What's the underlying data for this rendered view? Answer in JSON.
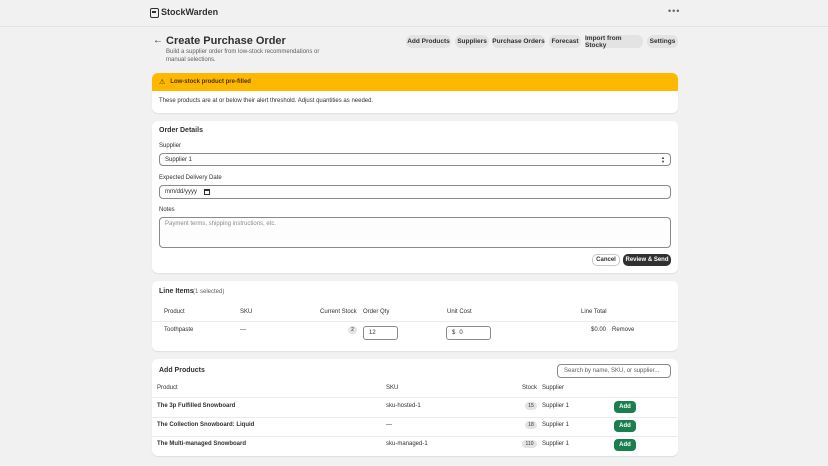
{
  "app": {
    "name": "StockWarden",
    "more_icon": "more-horizontal-icon"
  },
  "header": {
    "title": "Create Purchase Order",
    "subtitle": "Build a supplier order from low-stock recommendations or manual selections.",
    "back_icon": "arrow-left-icon"
  },
  "nav": {
    "tabs": [
      {
        "label": "Add Products"
      },
      {
        "label": "Suppliers"
      },
      {
        "label": "Purchase Orders"
      },
      {
        "label": "Forecast"
      },
      {
        "label": "Import from Stocky"
      },
      {
        "label": "Settings"
      }
    ]
  },
  "banner": {
    "title": "Low-stock product pre-filled",
    "body": "These products are at or below their alert threshold. Adjust quantities as needed.",
    "icon": "warning-icon",
    "color": "#ffb800"
  },
  "order_details": {
    "title": "Order Details",
    "supplier_label": "Supplier",
    "supplier_value": "Supplier 1",
    "delivery_label": "Expected Delivery Date",
    "delivery_value": "mm/dd/yyyy",
    "notes_label": "Notes",
    "notes_placeholder": "Payment terms, shipping instructions, etc.",
    "cancel_label": "Cancel",
    "submit_label": "Review & Send"
  },
  "line_items": {
    "title": "Line Items",
    "selected_text": "(1 selected)",
    "columns": [
      "Product",
      "SKU",
      "Current Stock",
      "Order Qty",
      "Unit Cost",
      "Line Total"
    ],
    "rows": [
      {
        "product": "Toothpaste",
        "sku": "—",
        "stock": "2",
        "qty": "12",
        "currency": "$",
        "cost": "0",
        "total": "$0.00",
        "remove": "Remove"
      }
    ]
  },
  "add_products": {
    "title": "Add Products",
    "search_placeholder": "Search by name, SKU, or supplier...",
    "columns": [
      "Product",
      "SKU",
      "Stock",
      "Supplier"
    ],
    "rows": [
      {
        "product": "The 3p Fulfilled Snowboard",
        "sku": "sku-hosted-1",
        "stock": "15",
        "supplier": "Supplier 1",
        "action": "Add"
      },
      {
        "product": "The Collection Snowboard: Liquid",
        "sku": "—",
        "stock": "18",
        "supplier": "Supplier 1",
        "action": "Add"
      },
      {
        "product": "The Multi-managed Snowboard",
        "sku": "sku-managed-1",
        "stock": "110",
        "supplier": "Supplier 1",
        "action": "Add"
      }
    ]
  },
  "colors": {
    "accent": "#303030",
    "add_button": "#1a7f4f",
    "background": "#f1f1f1"
  }
}
